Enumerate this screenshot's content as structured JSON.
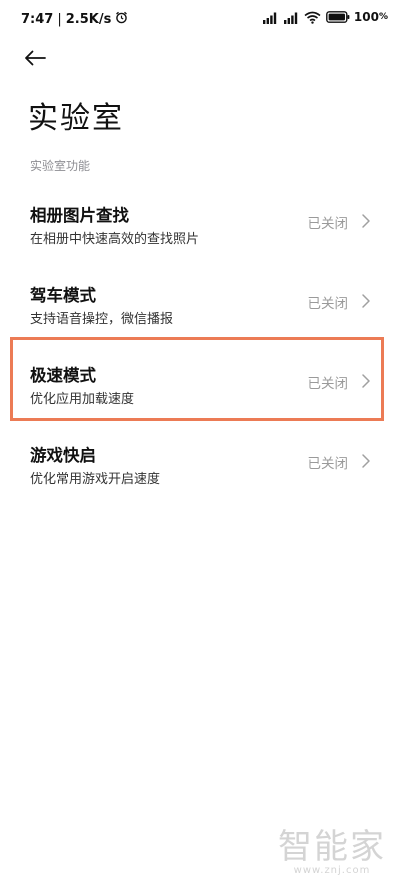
{
  "status_bar": {
    "time": "7:47",
    "network_speed": "2.5K/s",
    "separator": "|",
    "battery": "100",
    "icons": [
      "alarm-icon",
      "signal-icon",
      "signal-icon",
      "wifi-icon",
      "battery-icon"
    ]
  },
  "header": {
    "back_icon": "arrow-left-icon",
    "title": "实验室"
  },
  "section": {
    "header": "实验室功能"
  },
  "items": [
    {
      "title": "相册图片查找",
      "subtitle": "在相册中快速高效的查找照片",
      "status": "已关闭"
    },
    {
      "title": "驾车模式",
      "subtitle": "支持语音操控，微信播报",
      "status": "已关闭"
    },
    {
      "title": "极速模式",
      "subtitle": "优化应用加载速度",
      "status": "已关闭"
    },
    {
      "title": "游戏快启",
      "subtitle": "优化常用游戏开启速度",
      "status": "已关闭"
    }
  ],
  "highlight_color": "#ec7b55",
  "watermark": {
    "logo": "智能家",
    "url": "www.znj.com"
  }
}
